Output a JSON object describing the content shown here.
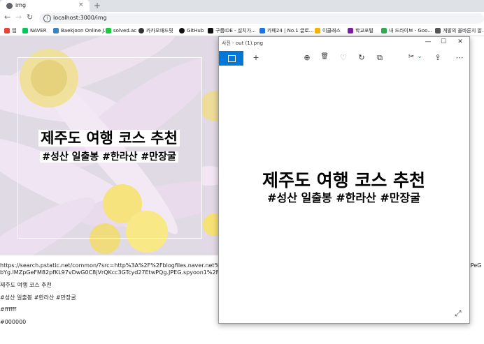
{
  "browser": {
    "tab_title": "img",
    "tab_close": "×",
    "new_tab": "+",
    "back": "←",
    "forward": "→",
    "reload": "↻",
    "url": "localhost:3000/img"
  },
  "bookmarks": [
    {
      "label": "앱",
      "color": "#ea4335"
    },
    {
      "label": "NAVER",
      "color": "#03c75a"
    },
    {
      "label": "Baekjoon Online J...",
      "color": "#3b82c4"
    },
    {
      "label": "solved.ac",
      "color": "#17ce3a"
    },
    {
      "label": "카카오애드핏",
      "color": "#333333"
    },
    {
      "label": "GitHub",
      "color": "#111111"
    },
    {
      "label": "구름IDE - 설치가...",
      "color": "#111111"
    },
    {
      "label": "카페24 | No.1 글로...",
      "color": "#1a73e8"
    },
    {
      "label": "이클래스",
      "color": "#f4b400"
    },
    {
      "label": "학교포털",
      "color": "#7b1fa2"
    },
    {
      "label": "내 드라이브 - Goo...",
      "color": "#34a853"
    },
    {
      "label": "개발의 올바른지 알...",
      "color": "#555555"
    }
  ],
  "canvas": {
    "title": "제주도 여행 코스 추천",
    "subtitle": "#성산 일출봉 #한라산 #만장굴"
  },
  "page_text": {
    "src_line1": "https://search.pstatic.net/common/?src=http%3A%2F%2Fblogfiles.naver.net%2F",
    "src_line1_end": "CtPeG",
    "src_line2": "bYg.lMZpGeFM82pfKL97vDwG0C8jVrQKcc3GTcyd27EtwPQg.JPEG.spyoon1%2F",
    "title": "제주도 여행 코스 추천",
    "tags": "#성산 일출봉 #한라산 #만장굴",
    "bg_color": "#ffffff",
    "fg_color": "#000000"
  },
  "photos": {
    "window_title": "사진 - out (1).png",
    "minimize": "—",
    "maximize": "☐",
    "close": "✕",
    "add": "+",
    "zoom": "⊕",
    "delete": "🗑",
    "favorite": "♡",
    "rotate": "↻",
    "crop": "⧉",
    "edit_dropdown": "⌄",
    "share": "⇪",
    "more": "⋯",
    "image_title": "제주도 여행 코스 추천",
    "image_subtitle": "#성산 일출봉 #한라산 #만장굴",
    "expand": "⤢"
  },
  "colors": {
    "accent": "#0078d7",
    "petal": "#e8c6e6",
    "flower_center": "#f2d43a"
  }
}
